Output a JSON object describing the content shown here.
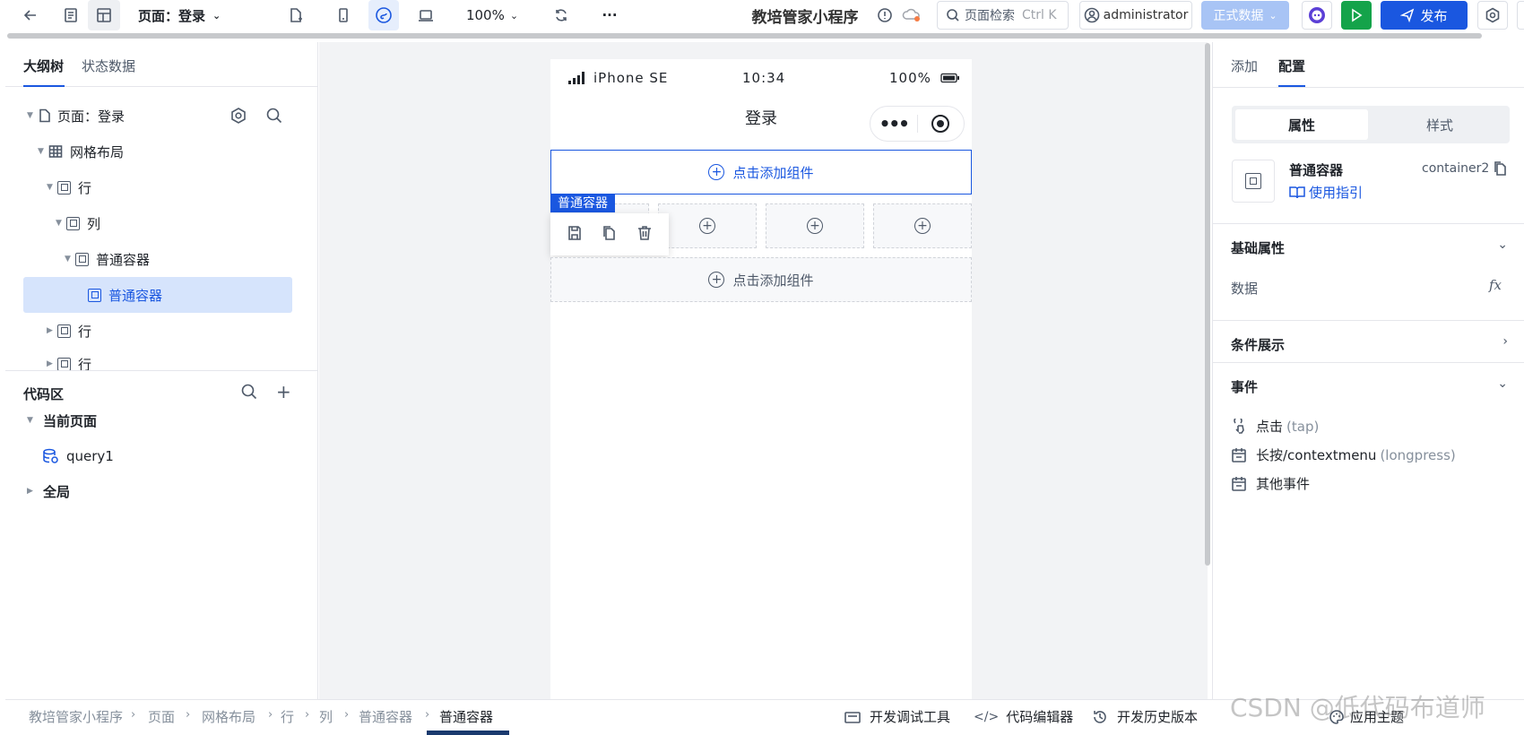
{
  "topbar": {
    "back_icon": "arrow-left-icon",
    "page_selector": "页面：登录",
    "zoom": "100%",
    "more": "···",
    "app_title": "教培管家小程序",
    "search_placeholder": "页面检索",
    "search_shortcut": "Ctrl K",
    "user": "administrator",
    "env_label": "正式数据",
    "publish_label": "发布"
  },
  "left": {
    "tabs": [
      "大纲树",
      "状态数据"
    ],
    "tree": [
      {
        "label": "页面：登录"
      },
      {
        "label": "网格布局"
      },
      {
        "label": "行"
      },
      {
        "label": "列"
      },
      {
        "label": "普通容器"
      },
      {
        "label": "普通容器"
      },
      {
        "label": "行"
      },
      {
        "label": "行"
      }
    ],
    "code_title": "代码区",
    "code_items": [
      {
        "label": "当前页面"
      },
      {
        "label": "query1"
      },
      {
        "label": "全局"
      }
    ]
  },
  "phone": {
    "carrier": "iPhone SE",
    "time": "10:34",
    "battery": "100%",
    "title": "登录",
    "add_component": "点击添加组件",
    "tag": "普通容器"
  },
  "right": {
    "tabs": [
      "添加",
      "配置"
    ],
    "segments": [
      "属性",
      "样式"
    ],
    "component_name": "普通容器",
    "component_id": "container2",
    "guide_link": "使用指引",
    "basic_title": "基础属性",
    "data_label": "数据",
    "fx": "fx",
    "condition_title": "条件展示",
    "events_title": "事件",
    "events": [
      {
        "label": "点击",
        "hint": "(tap)"
      },
      {
        "label": "长按/contextmenu",
        "hint": "(longpress)"
      },
      {
        "label": "其他事件",
        "hint": ""
      }
    ]
  },
  "bottom": {
    "breadcrumb": [
      "教培管家小程序",
      "页面",
      "网格布局",
      "行",
      "列",
      "普通容器",
      "普通容器"
    ],
    "tools": [
      "开发调试工具",
      "代码编辑器",
      "开发历史版本",
      "应用主题"
    ]
  },
  "watermark": "CSDN @低代码布道师",
  "colors": {
    "accent": "#1a57e0",
    "run_green": "#14a34a",
    "env_disabled": "#a8c4f5"
  }
}
